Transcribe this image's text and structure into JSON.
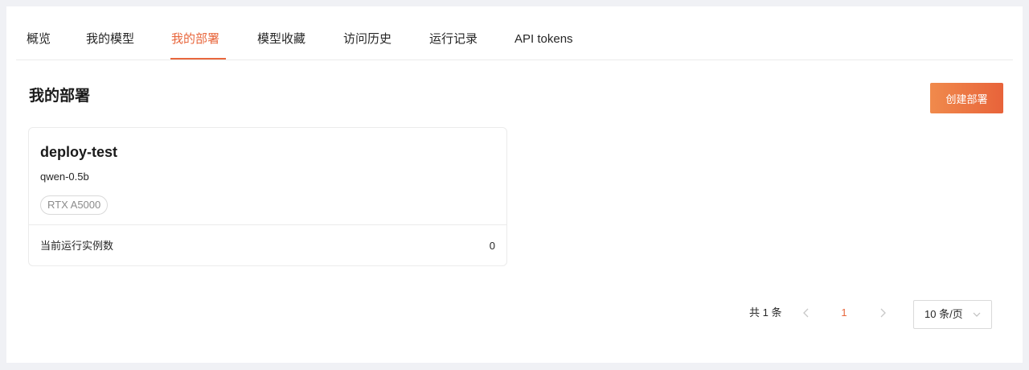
{
  "tabs": [
    {
      "label": "概览"
    },
    {
      "label": "我的模型"
    },
    {
      "label": "我的部署",
      "active": true
    },
    {
      "label": "模型收藏"
    },
    {
      "label": "访问历史"
    },
    {
      "label": "运行记录"
    },
    {
      "label": "API tokens"
    }
  ],
  "page": {
    "title": "我的部署",
    "create_button": "创建部署"
  },
  "deployments": [
    {
      "name": "deploy-test",
      "model": "qwen-0.5b",
      "gpu_tag": "RTX A5000",
      "instances_label": "当前运行实例数",
      "instances_value": "0"
    }
  ],
  "pagination": {
    "total": "共 1 条",
    "current_page": "1",
    "page_size": "10 条/页",
    "prev_icon": "chevron-left-icon",
    "next_icon": "chevron-right-icon"
  },
  "colors": {
    "accent": "#e8673d",
    "background": "#f0f1f5",
    "panel": "#ffffff",
    "border": "#ebebeb"
  }
}
